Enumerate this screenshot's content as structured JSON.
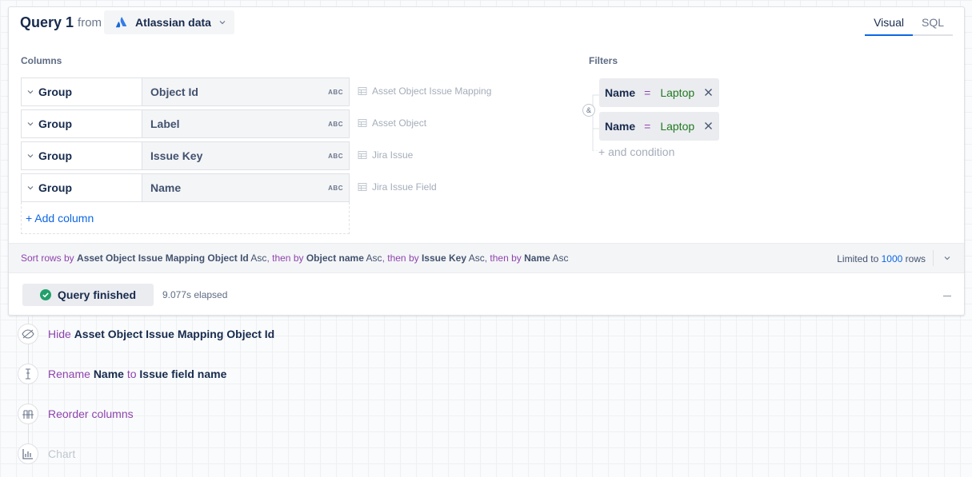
{
  "query": {
    "title": "Query 1",
    "from_label": "from",
    "source": "Atlassian data",
    "tabs": [
      {
        "label": "Visual",
        "active": true
      },
      {
        "label": "SQL",
        "active": false
      }
    ]
  },
  "columns": {
    "heading": "Columns",
    "rows": [
      {
        "aggregation": "Group",
        "field": "Object Id",
        "type": "ABC",
        "table": "Asset Object Issue Mapping"
      },
      {
        "aggregation": "Group",
        "field": "Label",
        "type": "ABC",
        "table": "Asset Object"
      },
      {
        "aggregation": "Group",
        "field": "Issue Key",
        "type": "ABC",
        "table": "Jira Issue"
      },
      {
        "aggregation": "Group",
        "field": "Name",
        "type": "ABC",
        "table": "Jira Issue Field"
      }
    ],
    "add_label": "+ Add column"
  },
  "filters": {
    "heading": "Filters",
    "joiner": "&",
    "items": [
      {
        "field": "Name",
        "op": "=",
        "value": "Laptop"
      },
      {
        "field": "Name",
        "op": "=",
        "value": "Laptop"
      }
    ],
    "add_label": "+ and condition"
  },
  "sort": {
    "prefix": "Sort rows by",
    "then": "then by",
    "comma": ",",
    "items": [
      {
        "field": "Asset Object Issue Mapping Object Id",
        "dir": "Asc"
      },
      {
        "field": "Object name",
        "dir": "Asc"
      },
      {
        "field": "Issue Key",
        "dir": "Asc"
      },
      {
        "field": "Name",
        "dir": "Asc"
      }
    ],
    "limit_prefix": "Limited to",
    "limit_value": "1000",
    "limit_suffix": "rows"
  },
  "status": {
    "label": "Query finished",
    "elapsed": "9.077s elapsed"
  },
  "steps": [
    {
      "icon": "hide-icon",
      "verb": "Hide",
      "target": "Asset Object Issue Mapping Object Id"
    },
    {
      "icon": "rename-icon",
      "verb": "Rename",
      "target": "Name",
      "joiner": "to",
      "target2": "Issue field name"
    },
    {
      "icon": "reorder-icon",
      "verb": "Reorder columns"
    },
    {
      "icon": "chart-icon",
      "verb": "Chart"
    }
  ],
  "colors": {
    "accent": "#0c66e4",
    "keyword": "#8e44ad",
    "value": "#1f7a1f",
    "success": "#22a06b"
  }
}
